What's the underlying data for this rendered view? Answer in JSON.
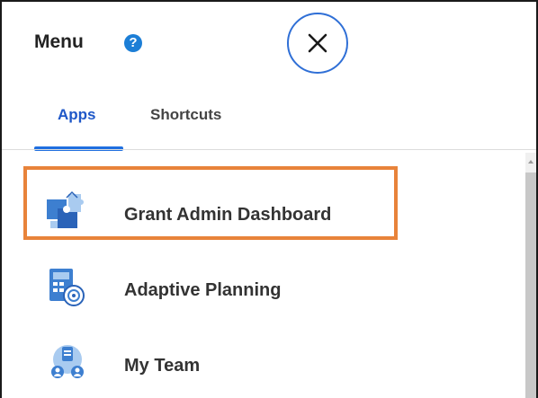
{
  "menu": {
    "title": "Menu",
    "help_glyph": "?",
    "tabs": [
      {
        "label": "Apps",
        "active": true
      },
      {
        "label": "Shortcuts",
        "active": false
      }
    ],
    "items": [
      {
        "label": "Grant Admin Dashboard",
        "icon": "puzzle-dashboard-icon",
        "highlighted": true
      },
      {
        "label": "Adaptive Planning",
        "icon": "calculator-target-icon",
        "highlighted": false
      },
      {
        "label": "My Team",
        "icon": "team-icon",
        "highlighted": false
      }
    ]
  },
  "colors": {
    "accent": "#1f6fe0",
    "highlight_border": "#e8833a",
    "icon_blue": "#4a90d9"
  }
}
